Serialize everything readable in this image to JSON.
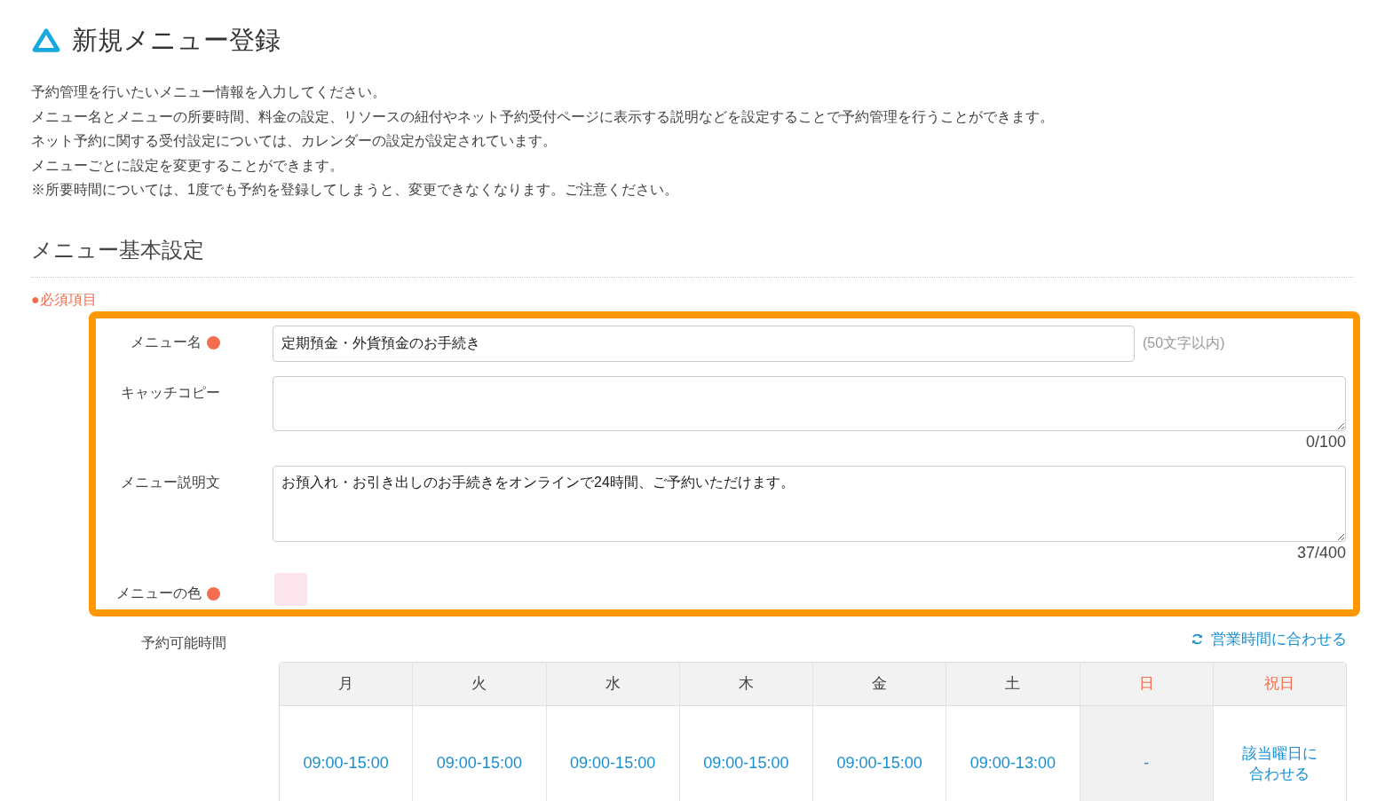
{
  "page": {
    "title": "新規メニュー登録"
  },
  "intro": [
    "予約管理を行いたいメニュー情報を入力してください。",
    "メニュー名とメニューの所要時間、料金の設定、リソースの紐付やネット予約受付ページに表示する説明などを設定することで予約管理を行うことができます。",
    "ネット予約に関する受付設定については、カレンダーの設定が設定されています。",
    "メニューごとに設定を変更することができます。",
    "※所要時間については、1度でも予約を登録してしまうと、変更できなくなります。ご注意ください。"
  ],
  "section": {
    "title": "メニュー基本設定",
    "required_note": "●必須項目"
  },
  "form": {
    "highlighted": true,
    "fields": [
      {
        "kind": "text",
        "label": "メニュー名",
        "required": true,
        "value": "定期預金・外貨預金のお手続き",
        "hint": "(50文字以内)"
      },
      {
        "kind": "textarea",
        "label": "キャッチコピー",
        "required": false,
        "counter": "0/100"
      },
      {
        "kind": "textarea",
        "label": "メニュー説明文",
        "required": false,
        "value": "お預入れ・お引き出しのお手続きをオンラインで24時間、ご予約いただけます。",
        "counter": "37/400"
      },
      {
        "kind": "color",
        "label": "メニューの色",
        "required": true,
        "color": "#fce4ec"
      }
    ]
  },
  "availability": {
    "label": "予約可能時間",
    "sync_link": "営業時間に合わせる",
    "days": [
      {
        "label": "月",
        "holiday": false,
        "closed": false,
        "value": "09:00-15:00"
      },
      {
        "label": "火",
        "holiday": false,
        "closed": false,
        "value": "09:00-15:00"
      },
      {
        "label": "水",
        "holiday": false,
        "closed": false,
        "value": "09:00-15:00"
      },
      {
        "label": "木",
        "holiday": false,
        "closed": false,
        "value": "09:00-15:00"
      },
      {
        "label": "金",
        "holiday": false,
        "closed": false,
        "value": "09:00-15:00"
      },
      {
        "label": "土",
        "holiday": false,
        "closed": false,
        "value": "09:00-13:00"
      },
      {
        "label": "日",
        "holiday": true,
        "closed": true,
        "value": "-"
      },
      {
        "label": "祝日",
        "holiday": true,
        "closed": false,
        "value": "該当曜日に合わせる"
      }
    ]
  }
}
